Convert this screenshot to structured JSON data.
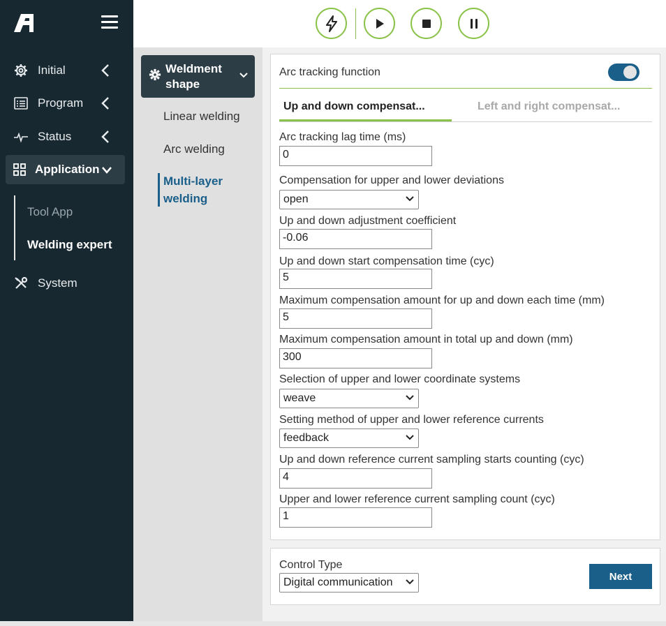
{
  "sidebar": {
    "items": [
      {
        "label": "Initial",
        "icon": "gear-icon"
      },
      {
        "label": "Program",
        "icon": "list-icon"
      },
      {
        "label": "Status",
        "icon": "pulse-icon"
      },
      {
        "label": "Application",
        "icon": "grid-icon"
      },
      {
        "label": "System",
        "icon": "tools-icon"
      }
    ],
    "sub_items": [
      {
        "label": "Tool App"
      },
      {
        "label": "Welding expert"
      }
    ]
  },
  "toolbar": {
    "buttons": [
      "lightning-icon",
      "play-icon",
      "stop-icon",
      "pause-icon"
    ]
  },
  "middle": {
    "shape_label": "Weldment shape",
    "items": [
      {
        "label": "Linear welding"
      },
      {
        "label": "Arc welding"
      },
      {
        "label": "Multi-layer welding"
      }
    ]
  },
  "form": {
    "arc_title": "Arc tracking function",
    "arc_enabled": true,
    "tabs": [
      "Up and down compensat...",
      "Left and right compensat..."
    ],
    "fields": [
      {
        "label": "Arc tracking lag time (ms)",
        "value": "0",
        "type": "input"
      },
      {
        "label": "Compensation for upper and lower deviations",
        "value": "open",
        "type": "select"
      },
      {
        "label": "Up and down adjustment coefficient",
        "value": "-0.06",
        "type": "input"
      },
      {
        "label": "Up and down start compensation time (cyc)",
        "value": "5",
        "type": "input"
      },
      {
        "label": "Maximum compensation amount for up and down each time (mm)",
        "value": "5",
        "type": "input"
      },
      {
        "label": "Maximum compensation amount in total up and down (mm)",
        "value": "300",
        "type": "input"
      },
      {
        "label": "Selection of upper and lower coordinate systems",
        "value": "weave",
        "type": "select"
      },
      {
        "label": "Setting method of upper and lower reference currents",
        "value": "feedback",
        "type": "select"
      },
      {
        "label": "Up and down reference current sampling starts counting (cyc)",
        "value": "4",
        "type": "input"
      },
      {
        "label": "Upper and lower reference current sampling count (cyc)",
        "value": "1",
        "type": "input"
      }
    ]
  },
  "footer": {
    "control_type_label": "Control Type",
    "control_type_value": "Digital communication",
    "next_label": "Next"
  },
  "colors": {
    "sidebar_bg": "#172830",
    "active_bg": "#2c3d45",
    "accent_green": "#8bc34a",
    "accent_blue": "#1a5f8a"
  }
}
